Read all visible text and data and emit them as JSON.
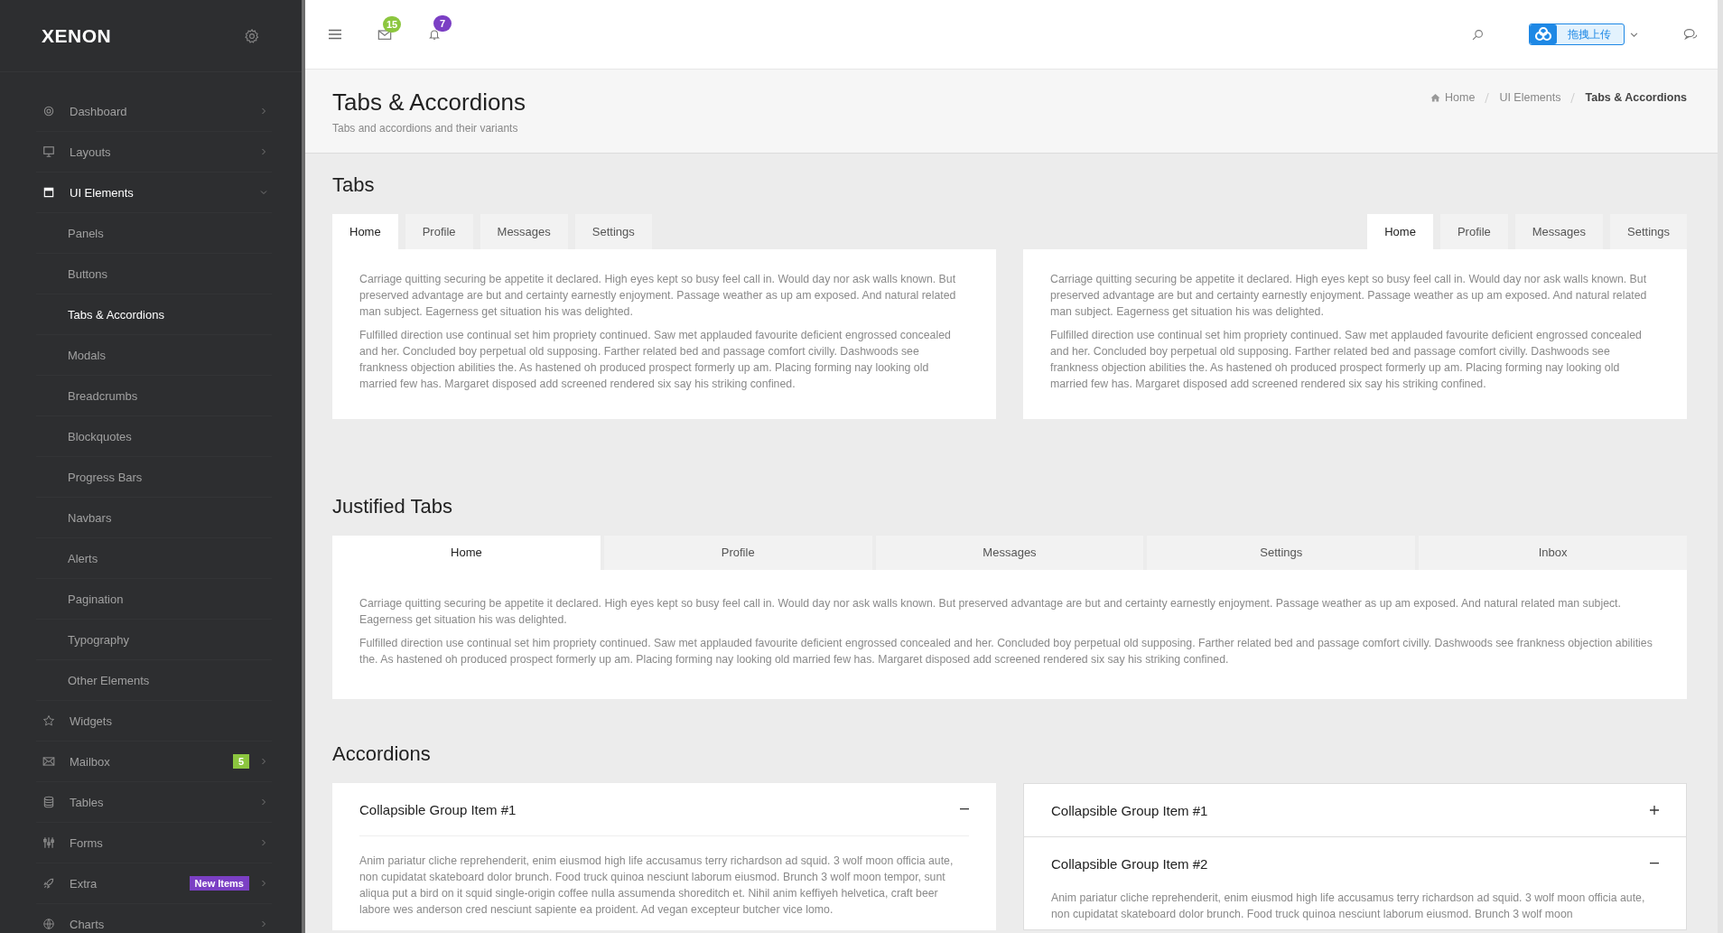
{
  "sidebar": {
    "logo": "XENON",
    "items": [
      {
        "label": "Dashboard",
        "kind": "group",
        "selected": false,
        "expanded": false
      },
      {
        "label": "Layouts",
        "kind": "group",
        "selected": false,
        "expanded": false
      },
      {
        "label": "UI Elements",
        "kind": "group",
        "selected": true,
        "expanded": true
      },
      {
        "label": "Panels",
        "kind": "sub",
        "selected": false
      },
      {
        "label": "Buttons",
        "kind": "sub",
        "selected": false
      },
      {
        "label": "Tabs & Accordions",
        "kind": "sub",
        "selected": true
      },
      {
        "label": "Modals",
        "kind": "sub",
        "selected": false
      },
      {
        "label": "Breadcrumbs",
        "kind": "sub",
        "selected": false
      },
      {
        "label": "Blockquotes",
        "kind": "sub",
        "selected": false
      },
      {
        "label": "Progress Bars",
        "kind": "sub",
        "selected": false
      },
      {
        "label": "Navbars",
        "kind": "sub",
        "selected": false
      },
      {
        "label": "Alerts",
        "kind": "sub",
        "selected": false
      },
      {
        "label": "Pagination",
        "kind": "sub",
        "selected": false
      },
      {
        "label": "Typography",
        "kind": "sub",
        "selected": false
      },
      {
        "label": "Other Elements",
        "kind": "sub",
        "selected": false
      },
      {
        "label": "Widgets",
        "kind": "link",
        "selected": false
      },
      {
        "label": "Mailbox",
        "kind": "group",
        "selected": false,
        "expanded": false,
        "badge": {
          "text": "5",
          "color": "#8cc63f"
        }
      },
      {
        "label": "Tables",
        "kind": "group",
        "selected": false,
        "expanded": false
      },
      {
        "label": "Forms",
        "kind": "group",
        "selected": false,
        "expanded": false
      },
      {
        "label": "Extra",
        "kind": "group",
        "selected": false,
        "expanded": false,
        "badge": {
          "text": "New Items",
          "color": "#7b3fc4"
        }
      },
      {
        "label": "Charts",
        "kind": "group",
        "selected": false,
        "expanded": false
      }
    ]
  },
  "topbar": {
    "mail_badge": {
      "text": "15",
      "color": "#8cc63f"
    },
    "bell_badge": {
      "text": "7",
      "color": "#7b3fc4"
    },
    "upload_button": "拖拽上传"
  },
  "page_header": {
    "title": "Tabs & Accordions",
    "subtitle": "Tabs and accordions and their variants",
    "breadcrumbs": [
      {
        "label": "Home",
        "current": false
      },
      {
        "label": "UI Elements",
        "current": false
      },
      {
        "label": "Tabs & Accordions",
        "current": true
      }
    ]
  },
  "tabs_section": {
    "heading": "Tabs",
    "panels": [
      {
        "tabs": [
          {
            "label": "Home",
            "selected": true
          },
          {
            "label": "Profile",
            "selected": false
          },
          {
            "label": "Messages",
            "selected": false
          },
          {
            "label": "Settings",
            "selected": false
          }
        ],
        "paragraphs": [
          "Carriage quitting securing be appetite it declared. High eyes kept so busy feel call in. Would day nor ask walls known. But preserved advantage are but and certainty earnestly enjoyment. Passage weather as up am exposed. And natural related man subject. Eagerness get situation his was delighted.",
          "Fulfilled direction use continual set him propriety continued. Saw met applauded favourite deficient engrossed concealed and her. Concluded boy perpetual old supposing. Farther related bed and passage comfort civilly. Dashwoods see frankness objection abilities the. As hastened oh produced prospect formerly up am. Placing forming nay looking old married few has. Margaret disposed add screened rendered six say his striking confined."
        ]
      },
      {
        "tabs": [
          {
            "label": "Home",
            "selected": true
          },
          {
            "label": "Profile",
            "selected": false
          },
          {
            "label": "Messages",
            "selected": false
          },
          {
            "label": "Settings",
            "selected": false
          }
        ],
        "paragraphs": [
          "Carriage quitting securing be appetite it declared. High eyes kept so busy feel call in. Would day nor ask walls known. But preserved advantage are but and certainty earnestly enjoyment. Passage weather as up am exposed. And natural related man subject. Eagerness get situation his was delighted.",
          "Fulfilled direction use continual set him propriety continued. Saw met applauded favourite deficient engrossed concealed and her. Concluded boy perpetual old supposing. Farther related bed and passage comfort civilly. Dashwoods see frankness objection abilities the. As hastened oh produced prospect formerly up am. Placing forming nay looking old married few has. Margaret disposed add screened rendered six say his striking confined."
        ]
      }
    ]
  },
  "justified_section": {
    "heading": "Justified Tabs",
    "tabs": [
      {
        "label": "Home",
        "selected": true
      },
      {
        "label": "Profile",
        "selected": false
      },
      {
        "label": "Messages",
        "selected": false
      },
      {
        "label": "Settings",
        "selected": false
      },
      {
        "label": "Inbox",
        "selected": false
      }
    ],
    "paragraphs": [
      "Carriage quitting securing be appetite it declared. High eyes kept so busy feel call in. Would day nor ask walls known. But preserved advantage are but and certainty earnestly enjoyment. Passage weather as up am exposed. And natural related man subject. Eagerness get situation his was delighted.",
      "Fulfilled direction use continual set him propriety continued. Saw met applauded favourite deficient engrossed concealed and her. Concluded boy perpetual old supposing. Farther related bed and passage comfort civilly. Dashwoods see frankness objection abilities the. As hastened oh produced prospect formerly up am. Placing forming nay looking old married few has. Margaret disposed add screened rendered six say his striking confined."
    ]
  },
  "accordions_section": {
    "heading": "Accordions",
    "groups": [
      {
        "items": [
          {
            "title": "Collapsible Group Item #1",
            "expanded": true,
            "body": "Anim pariatur cliche reprehenderit, enim eiusmod high life accusamus terry richardson ad squid. 3 wolf moon officia aute, non cupidatat skateboard dolor brunch. Food truck quinoa nesciunt laborum eiusmod. Brunch 3 wolf moon tempor, sunt aliqua put a bird on it squid single-origin coffee nulla assumenda shoreditch et. Nihil anim keffiyeh helvetica, craft beer labore wes anderson cred nesciunt sapiente ea proident. Ad vegan excepteur butcher vice lomo."
          }
        ]
      },
      {
        "items": [
          {
            "title": "Collapsible Group Item #1",
            "expanded": false
          },
          {
            "title": "Collapsible Group Item #2",
            "expanded": true,
            "body": "Anim pariatur cliche reprehenderit, enim eiusmod high life accusamus terry richardson ad squid. 3 wolf moon officia aute, non cupidatat skateboard dolor brunch. Food truck quinoa nesciunt laborum eiusmod. Brunch 3 wolf moon"
          }
        ]
      }
    ]
  }
}
